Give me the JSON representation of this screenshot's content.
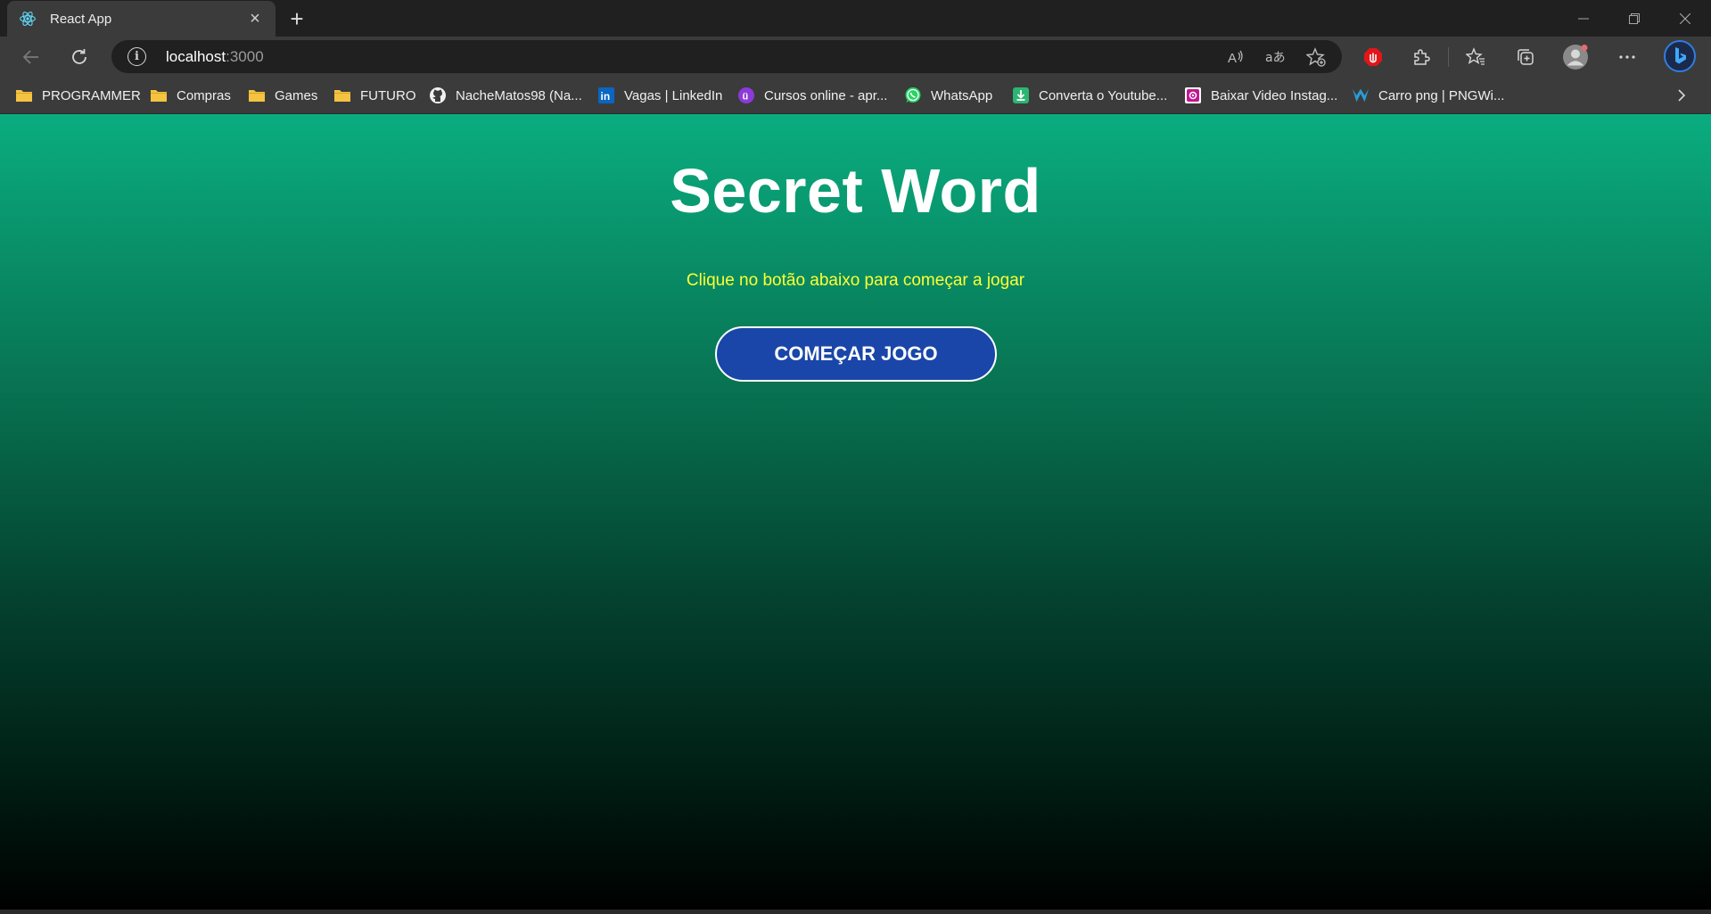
{
  "browser": {
    "tab": {
      "title": "React App",
      "favicon": "react-icon",
      "close": "×"
    },
    "new_tab": "+",
    "address": {
      "host": "localhost",
      "port": ":3000",
      "info_glyph": "i"
    },
    "toolbar_icons": [
      "back-icon",
      "refresh-icon",
      "read-aloud-icon",
      "translate-icon",
      "add-favorite-icon",
      "adblock-icon",
      "extensions-icon",
      "favorites-icon",
      "collections-icon",
      "profile-icon",
      "more-icon",
      "bing-icon"
    ],
    "bookmarks": [
      {
        "label": "PROGRAMMER",
        "icon": "folder-icon"
      },
      {
        "label": "Compras",
        "icon": "folder-icon"
      },
      {
        "label": "Games",
        "icon": "folder-icon"
      },
      {
        "label": "FUTURO",
        "icon": "folder-icon"
      },
      {
        "label": "NacheMatos98 (Na...",
        "icon": "github-icon"
      },
      {
        "label": "Vagas | LinkedIn",
        "icon": "linkedin-icon"
      },
      {
        "label": "Cursos online - apr...",
        "icon": "udemy-icon"
      },
      {
        "label": "WhatsApp",
        "icon": "whatsapp-icon"
      },
      {
        "label": "Converta o Youtube...",
        "icon": "download-icon"
      },
      {
        "label": "Baixar Video Instag...",
        "icon": "instagram-icon"
      },
      {
        "label": "Carro png | PNGWi...",
        "icon": "pngwing-icon"
      }
    ],
    "colors": {
      "frame": "#202020",
      "toolbar": "#3b3b3b"
    }
  },
  "page": {
    "title": "Secret Word",
    "subtitle": "Clique no botão abaixo para começar a jogar",
    "start_button": "COMEÇAR JOGO",
    "colors": {
      "gradient_top": "#0aad80",
      "gradient_bottom": "#000000",
      "subtitle": "#ffff33",
      "button": "#1946a8"
    }
  }
}
